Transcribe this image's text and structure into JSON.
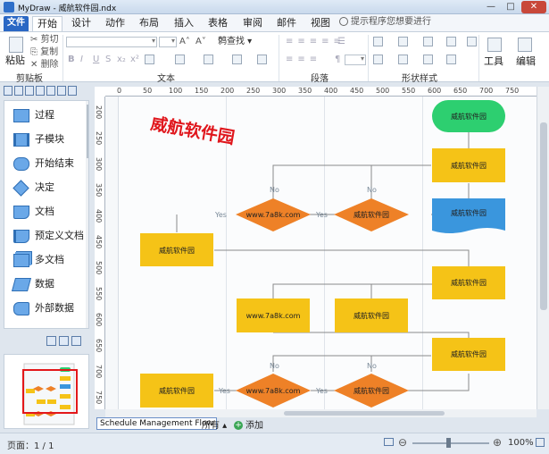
{
  "window": {
    "title": "MyDraw - 威航软件园.ndx",
    "minimize": "—",
    "maximize": "□",
    "close": "✕"
  },
  "tabs": {
    "file": "文件",
    "start": "开始",
    "design": "设计",
    "action": "动作",
    "layout": "布局",
    "insert": "插入",
    "table": "表格",
    "review": "审阅",
    "mail": "邮件",
    "view": "视图"
  },
  "search": {
    "placeholder": "提示程序您想要进行"
  },
  "ribbon": {
    "clipboard": {
      "paste": "粘贴",
      "cut": "剪切",
      "copy": "复制",
      "delete": "删除",
      "label": "剪贴板"
    },
    "text": {
      "label": "文本",
      "find": "查找",
      "find_prefix": "鹩"
    },
    "paragraph": {
      "label": "段落"
    },
    "shape_style": {
      "label": "形状样式"
    },
    "tools": {
      "label": "工具"
    },
    "edit": {
      "label": "编辑"
    }
  },
  "shape_panel": {
    "items": [
      "过程",
      "子模块",
      "开始结束",
      "决定",
      "文档",
      "预定义文档",
      "多文档",
      "数据",
      "外部数据"
    ]
  },
  "ruler": {
    "top": [
      "0",
      "50",
      "100",
      "150",
      "200",
      "250",
      "300",
      "350",
      "400",
      "450",
      "500",
      "550",
      "600",
      "650",
      "700",
      "750"
    ],
    "left": [
      "200",
      "250",
      "300",
      "350",
      "400",
      "450",
      "500",
      "550",
      "600",
      "650",
      "700",
      "750"
    ]
  },
  "diagram": {
    "watermark": "威航软件园",
    "box_label": "威航软件园",
    "diamond_site": "www.7a8k.com",
    "diamond_brand": "威航软件园",
    "box_site": "www.7a8k.com",
    "yes": "Yes",
    "no": "No",
    "colors": {
      "yellow": "#f5c317",
      "orange": "#ee8127",
      "green": "#2dcf70",
      "blue": "#3a96dd",
      "line": "#8a8a8a"
    }
  },
  "sheets": {
    "active": "Schedule Management Flow",
    "all": "所有",
    "add": "添加"
  },
  "status": {
    "page": "页面：1 / 1",
    "zoom": "100%"
  }
}
